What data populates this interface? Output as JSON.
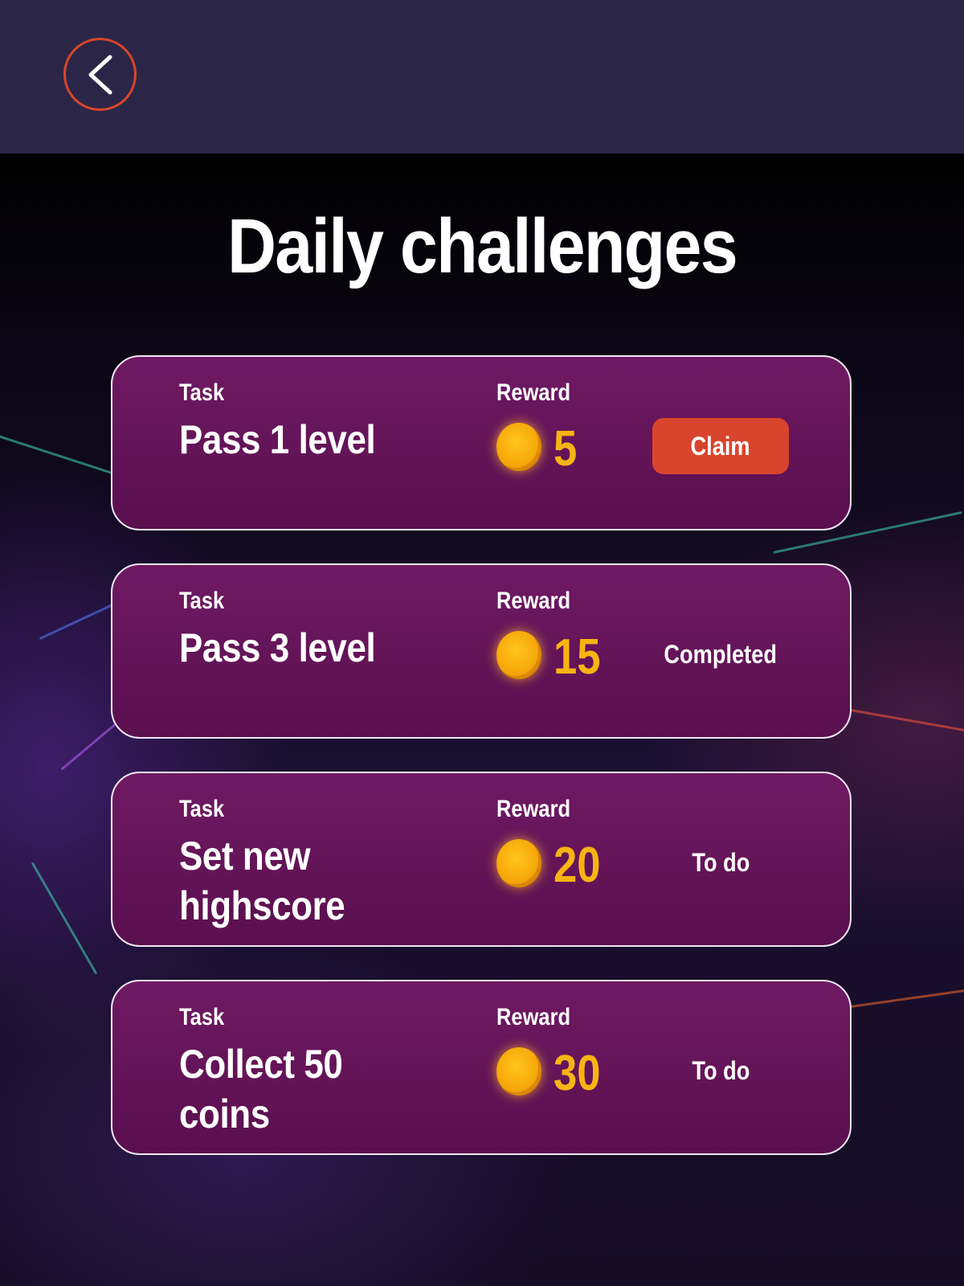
{
  "header": {
    "back_icon": "chevron-left-icon"
  },
  "title": "Daily challenges",
  "labels": {
    "task": "Task",
    "reward": "Reward"
  },
  "colors": {
    "accent": "#d8452c",
    "card": "#6f1a63",
    "coin": "#f7b413",
    "header": "#2b2647"
  },
  "challenges": [
    {
      "task": "Pass 1 level",
      "reward": "5",
      "status": "Claim"
    },
    {
      "task": "Pass 3 level",
      "reward": "15",
      "status": "Completed"
    },
    {
      "task": "Set new highscore",
      "reward": "20",
      "status": "To do"
    },
    {
      "task": "Collect 50 coins",
      "reward": "30",
      "status": "To do"
    }
  ]
}
